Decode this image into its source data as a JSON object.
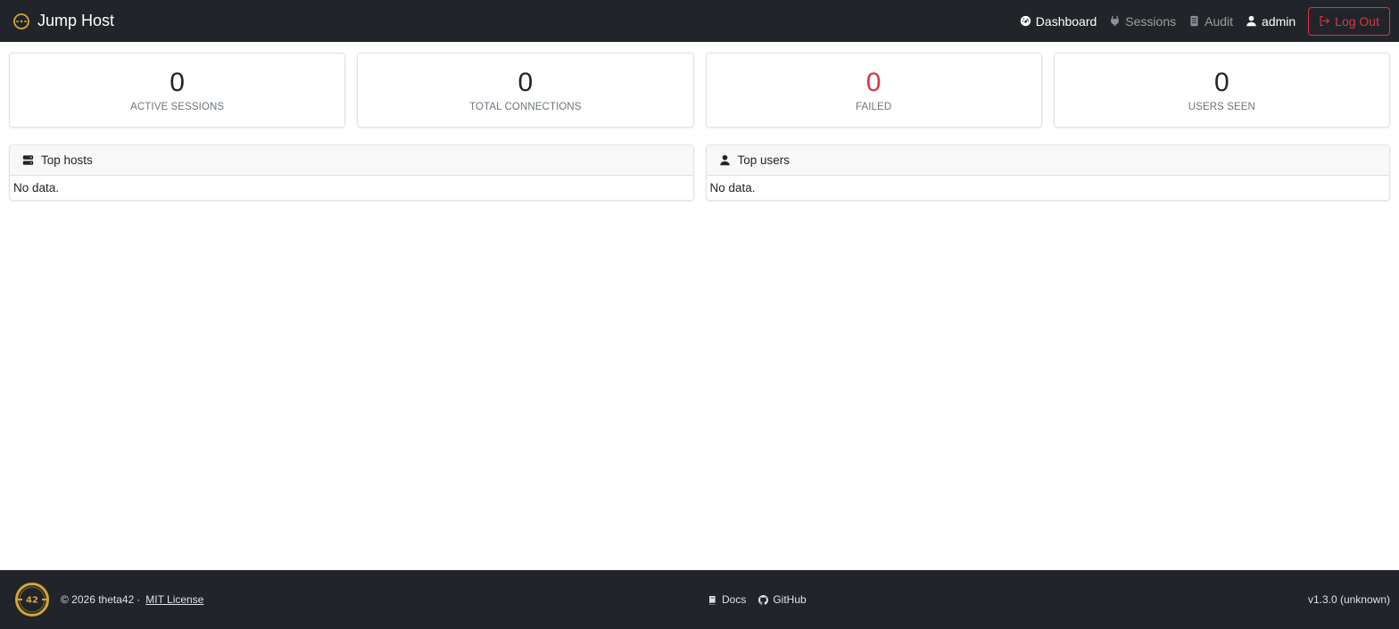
{
  "navbar": {
    "brand": "Jump Host",
    "links": {
      "dashboard": "Dashboard",
      "sessions": "Sessions",
      "audit": "Audit"
    },
    "user": "admin",
    "logout": "Log Out"
  },
  "stats": {
    "active_sessions": {
      "value": "0",
      "label": "ACTIVE SESSIONS"
    },
    "total_connections": {
      "value": "0",
      "label": "TOTAL CONNECTIONS"
    },
    "failed": {
      "value": "0",
      "label": "FAILED"
    },
    "users_seen": {
      "value": "0",
      "label": "USERS SEEN"
    }
  },
  "panels": {
    "top_hosts": {
      "title": "Top hosts",
      "body": "No data."
    },
    "top_users": {
      "title": "Top users",
      "body": "No data."
    }
  },
  "footer": {
    "logo_text": "42",
    "copyright": "© 2026 theta42",
    "separator": "·",
    "license": "MIT License",
    "docs": "Docs",
    "github": "GitHub",
    "version": "v1.3.0 (unknown)"
  },
  "colors": {
    "navbar_bg": "#212529",
    "danger": "#dc3545",
    "gold": "#d4a53c"
  }
}
